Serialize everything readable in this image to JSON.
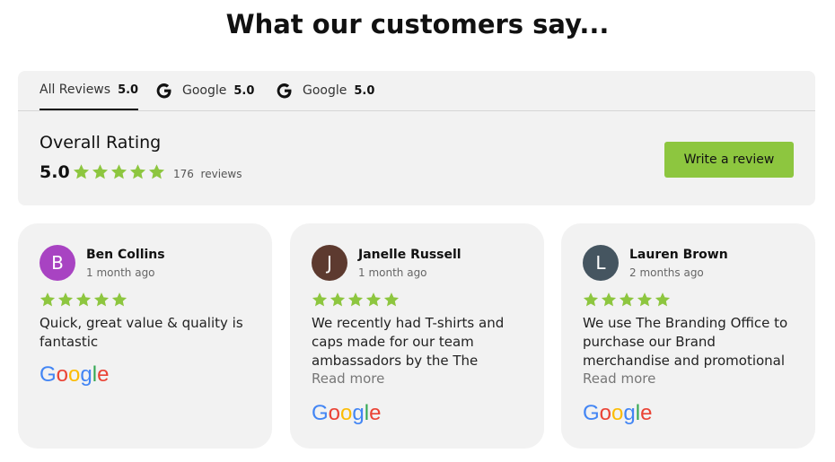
{
  "page_title": "What our customers say...",
  "tabs": [
    {
      "label": "All Reviews",
      "score": "5.0",
      "icon": null
    },
    {
      "label": "Google",
      "score": "5.0",
      "icon": "google-g-icon"
    },
    {
      "label": "Google",
      "score": "5.0",
      "icon": "google-g-icon"
    }
  ],
  "overall": {
    "label": "Overall Rating",
    "score": "5.0",
    "stars": 5,
    "count": "176",
    "count_suffix": "reviews",
    "write_review_label": "Write a review"
  },
  "colors": {
    "accent_green": "#8dc63f",
    "star_green": "#8dc63f",
    "panel_bg": "#f2f2f2"
  },
  "reviews": [
    {
      "initial": "B",
      "name": "Ben Collins",
      "date": "1 month ago",
      "stars": 5,
      "text": "Quick, great value & quality is fantastic",
      "read_more": "",
      "avatar_color": "#a843c2"
    },
    {
      "initial": "J",
      "name": "Janelle Russell",
      "date": "1 month ago",
      "stars": 5,
      "text": "We recently had T-shirts and caps made for our team ambassadors by the The",
      "read_more": "Read more",
      "avatar_color": "#5d3a2f"
    },
    {
      "initial": "L",
      "name": "Lauren Brown",
      "date": "2 months ago",
      "stars": 5,
      "text": "We use The Branding Office to purchase our Brand merchandise and promotional",
      "read_more": "Read more",
      "avatar_color": "#455560"
    }
  ]
}
